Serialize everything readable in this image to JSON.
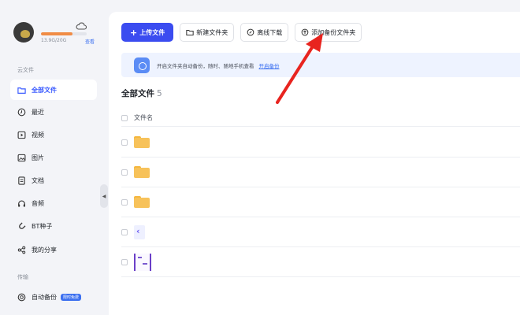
{
  "profile": {
    "quota_text": "13.9G/20G",
    "quota_link": "查看",
    "quota_fraction": 0.69
  },
  "sidebar": {
    "cloud_section": "云文件",
    "items": [
      {
        "label": "全部文件",
        "icon": "folder-icon",
        "active": true
      },
      {
        "label": "最近",
        "icon": "clock-icon"
      },
      {
        "label": "视频",
        "icon": "video-icon"
      },
      {
        "label": "图片",
        "icon": "image-icon"
      },
      {
        "label": "文档",
        "icon": "document-icon"
      },
      {
        "label": "音频",
        "icon": "headphones-icon"
      },
      {
        "label": "BT种子",
        "icon": "magnet-icon"
      },
      {
        "label": "我的分享",
        "icon": "share-icon"
      }
    ],
    "transfer_section": "传输",
    "auto_backup": {
      "label": "自动备份",
      "badge": "限时免费"
    }
  },
  "toolbar": {
    "upload": "上传文件",
    "new_folder": "新建文件夹",
    "offline_download": "离线下载",
    "add_backup_folder": "添加备份文件夹"
  },
  "banner": {
    "text": "开启文件夹自动备份，随时、随地手机查看",
    "link": "开启备份"
  },
  "file_list": {
    "title": "全部文件",
    "count": "5",
    "column_name": "文件名",
    "rows": [
      {
        "type": "folder"
      },
      {
        "type": "folder"
      },
      {
        "type": "folder"
      },
      {
        "type": "document"
      },
      {
        "type": "image"
      }
    ]
  },
  "colors": {
    "accent": "#3b4cf0",
    "annotation_arrow": "#e8241f",
    "folder": "#f7c25a"
  }
}
